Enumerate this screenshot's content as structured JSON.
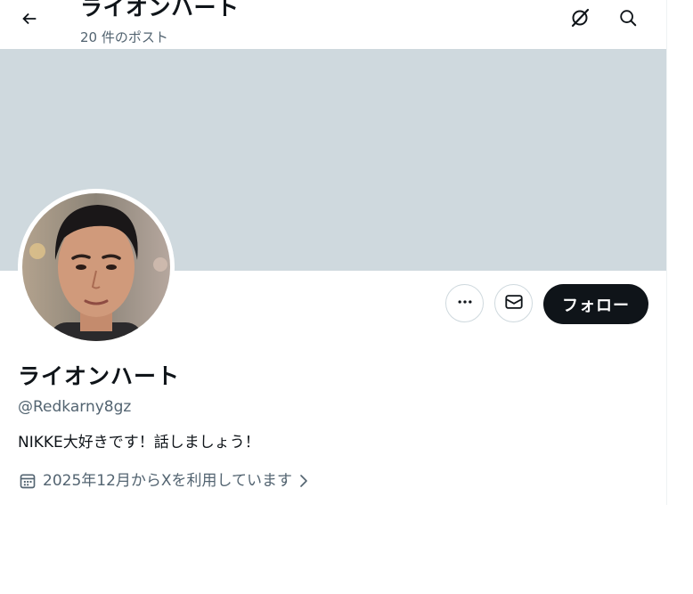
{
  "header": {
    "title": "ライオンハート",
    "post_count": "20 件のポスト"
  },
  "icons": {
    "back": "arrow-left-icon",
    "grok": "grok-icon",
    "search": "search-icon",
    "more": "more-horizontal-icon",
    "message": "envelope-icon",
    "calendar": "calendar-icon",
    "chevron": "chevron-right-icon"
  },
  "actions": {
    "follow_label": "フォロー"
  },
  "profile": {
    "display_name": "ライオンハート",
    "handle": "@Redkarny8gz",
    "bio": "NIKKE大好きです！話しましょう！",
    "joined": "2025年12月からXを利用しています"
  },
  "colors": {
    "banner": "#cfd9de",
    "primary_text": "#0f1419",
    "secondary_text": "#536471",
    "follow_button": "#0f1419"
  }
}
